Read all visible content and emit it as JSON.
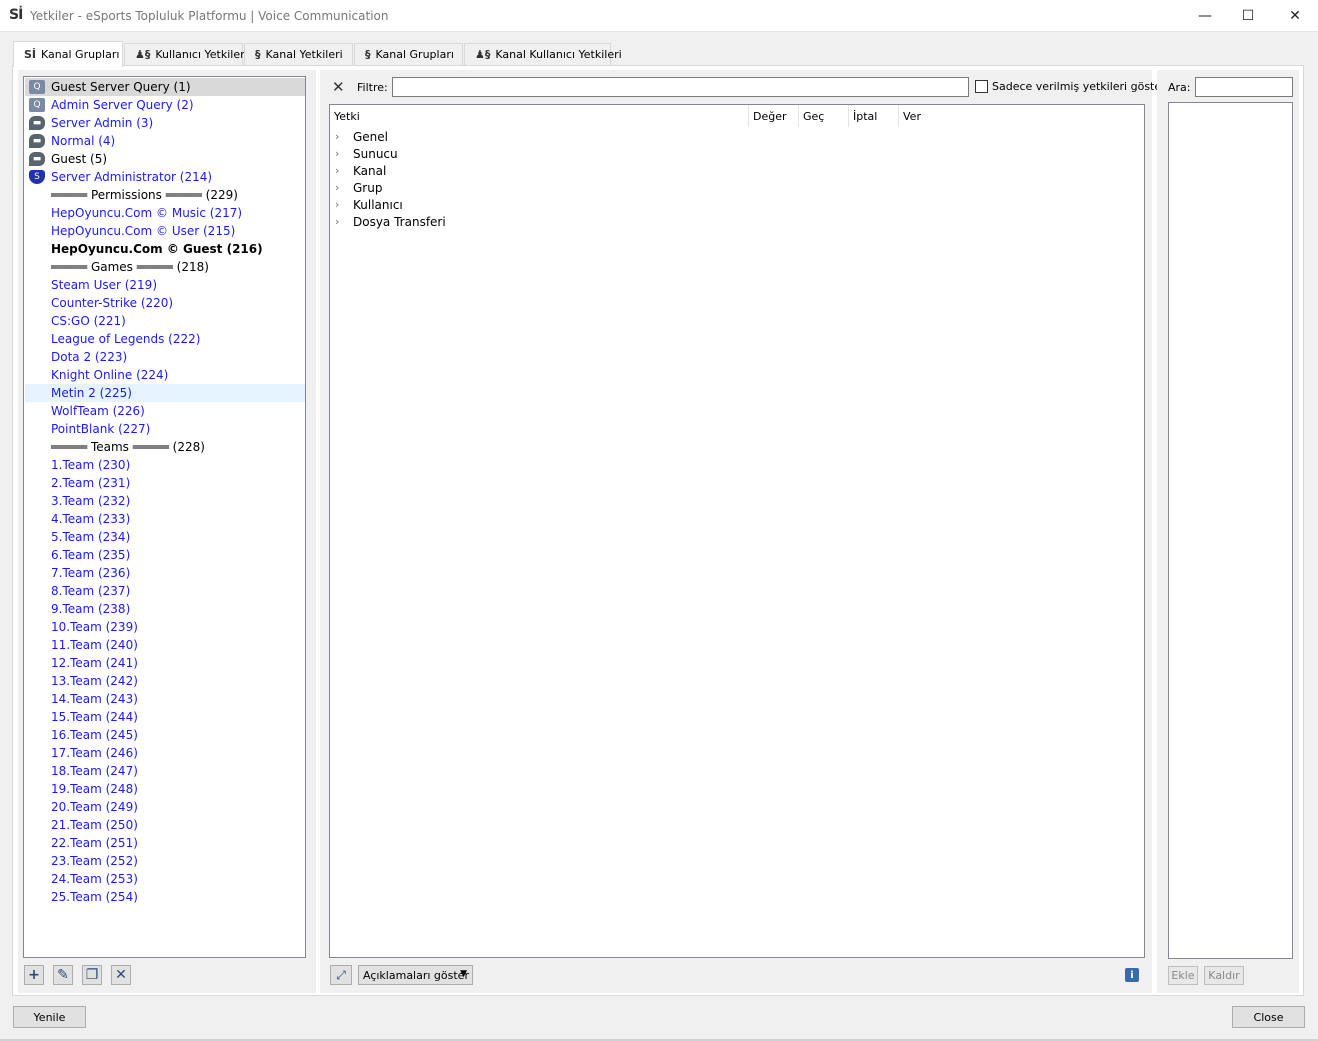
{
  "window": {
    "app_icon": "Sİ",
    "title": "Yetkiler - eSports Topluluk Platformu | Voice Communication",
    "minimize": "—",
    "maximize": "☐",
    "close": "✕"
  },
  "tabs": [
    {
      "label": "Kanal Grupları",
      "icon": "Sİ"
    },
    {
      "label": "Kullanıcı Yetkileri",
      "icon": "♟§"
    },
    {
      "label": "Kanal Yetkileri",
      "icon": "§"
    },
    {
      "label": "Kanal Grupları",
      "icon": "§"
    },
    {
      "label": "Kanal Kullanıcı Yetkileri",
      "icon": "♟§"
    }
  ],
  "groups": [
    {
      "label": "Guest Server Query (1)",
      "icon": "query"
    },
    {
      "label": "Admin Server Query (2)",
      "icon": "query"
    },
    {
      "label": "Server Admin (3)",
      "icon": "chat"
    },
    {
      "label": "Normal (4)",
      "icon": "chat"
    },
    {
      "label": "Guest (5)",
      "icon": "chat"
    },
    {
      "label": "Server Administrator (214)",
      "icon": "shield"
    },
    {
      "label": "═════ Permissions ═════ (229)",
      "icon": ""
    },
    {
      "label": "HepOyuncu.Com © Music (217)",
      "icon": ""
    },
    {
      "label": "HepOyuncu.Com © User (215)",
      "icon": ""
    },
    {
      "label": "HepOyuncu.Com © Guest (216)",
      "icon": ""
    },
    {
      "label": "═════ Games ═════ (218)",
      "icon": ""
    },
    {
      "label": "Steam User (219)",
      "icon": ""
    },
    {
      "label": "Counter-Strike (220)",
      "icon": ""
    },
    {
      "label": "CS:GO (221)",
      "icon": ""
    },
    {
      "label": "League of Legends (222)",
      "icon": ""
    },
    {
      "label": "Dota 2 (223)",
      "icon": ""
    },
    {
      "label": "Knight Online (224)",
      "icon": ""
    },
    {
      "label": "Metin 2 (225)",
      "icon": ""
    },
    {
      "label": "WolfTeam (226)",
      "icon": ""
    },
    {
      "label": "PointBlank (227)",
      "icon": ""
    },
    {
      "label": "═════ Teams ═════ (228)",
      "icon": ""
    },
    {
      "label": "1.Team (230)",
      "icon": ""
    },
    {
      "label": "2.Team (231)",
      "icon": ""
    },
    {
      "label": "3.Team (232)",
      "icon": ""
    },
    {
      "label": "4.Team (233)",
      "icon": ""
    },
    {
      "label": "5.Team (234)",
      "icon": ""
    },
    {
      "label": "6.Team (235)",
      "icon": ""
    },
    {
      "label": "7.Team (236)",
      "icon": ""
    },
    {
      "label": "8.Team (237)",
      "icon": ""
    },
    {
      "label": "9.Team (238)",
      "icon": ""
    },
    {
      "label": "10.Team (239)",
      "icon": ""
    },
    {
      "label": "11.Team (240)",
      "icon": ""
    },
    {
      "label": "12.Team (241)",
      "icon": ""
    },
    {
      "label": "13.Team (242)",
      "icon": ""
    },
    {
      "label": "14.Team (243)",
      "icon": ""
    },
    {
      "label": "15.Team (244)",
      "icon": ""
    },
    {
      "label": "16.Team (245)",
      "icon": ""
    },
    {
      "label": "17.Team (246)",
      "icon": ""
    },
    {
      "label": "18.Team (247)",
      "icon": ""
    },
    {
      "label": "19.Team (248)",
      "icon": ""
    },
    {
      "label": "20.Team (249)",
      "icon": ""
    },
    {
      "label": "21.Team (250)",
      "icon": ""
    },
    {
      "label": "22.Team (251)",
      "icon": ""
    },
    {
      "label": "23.Team (252)",
      "icon": ""
    },
    {
      "label": "24.Team (253)",
      "icon": ""
    },
    {
      "label": "25.Team (254)",
      "icon": ""
    }
  ],
  "group_buttons": {
    "add": "+",
    "edit": "✎",
    "copy": "❐",
    "delete": "✕"
  },
  "filter": {
    "clear": "✕",
    "label": "Filtre:",
    "value": "",
    "only_granted_label": "Sadece verilmiş yetkileri göster"
  },
  "columns": [
    "Yetki",
    "Değer",
    "Geç",
    "İptal",
    "Ver"
  ],
  "tree": [
    {
      "label": "Genel",
      "chevron": "›"
    },
    {
      "label": "Sunucu",
      "chevron": "›"
    },
    {
      "label": "Kanal",
      "chevron": "›"
    },
    {
      "label": "Grup",
      "chevron": "›"
    },
    {
      "label": "Kullanıcı",
      "chevron": "›"
    },
    {
      "label": "Dosya Transferi",
      "chevron": "›"
    }
  ],
  "center_footer": {
    "expand_icon": "⤢",
    "description_dropdown": "Açıklamaları göster",
    "dropdown_arrow": "▼",
    "info": "i"
  },
  "search": {
    "label": "Ara:",
    "value": "",
    "add": "Ekle",
    "remove": "Kaldır"
  },
  "bottom": {
    "refresh": "Yenile",
    "close": "Close"
  },
  "colors": {
    "link_blue": "#1a1aff",
    "selected_bg": "#d9d9d9",
    "hover_bg": "#e5f3ff"
  }
}
